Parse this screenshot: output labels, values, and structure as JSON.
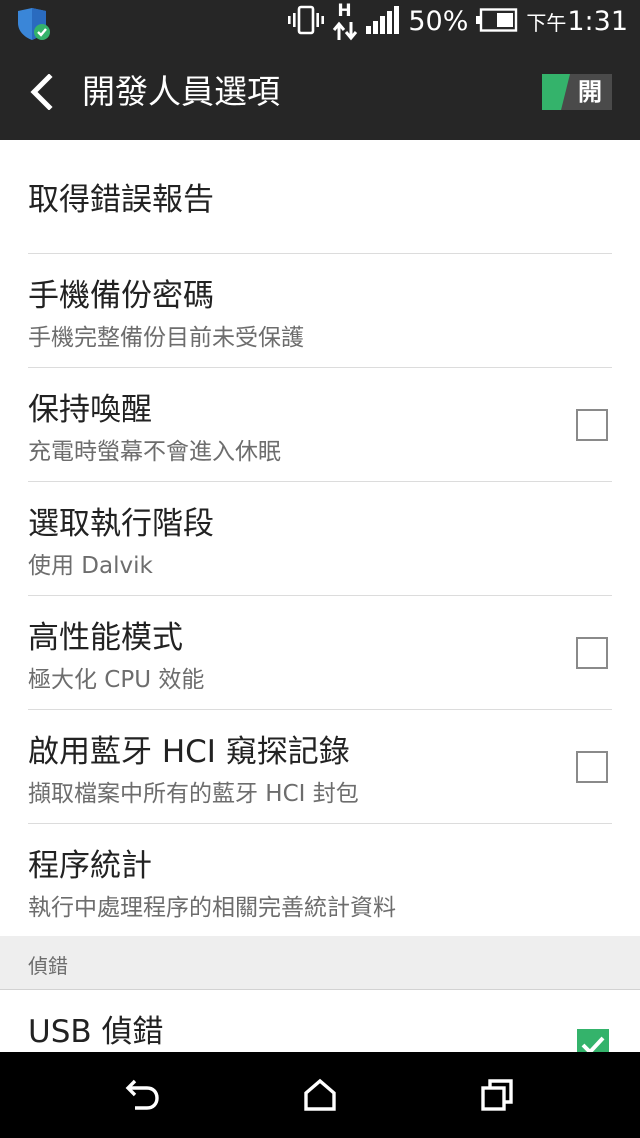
{
  "status_bar": {
    "signal_type": "H",
    "battery_percent": "50%",
    "ampm": "下午",
    "time": "1:31",
    "icons": [
      "shield-check-icon",
      "vibrate-icon",
      "data-arrows-icon",
      "signal-bars-icon",
      "battery-icon"
    ]
  },
  "header": {
    "title": "開發人員選項",
    "toggle_label": "開"
  },
  "settings": [
    {
      "title": "取得錯誤報告",
      "subtitle": ""
    },
    {
      "title": "手機備份密碼",
      "subtitle": "手機完整備份目前未受保護"
    },
    {
      "title": "保持喚醒",
      "subtitle": "充電時螢幕不會進入休眠",
      "checked": false
    },
    {
      "title": "選取執行階段",
      "subtitle": "使用 Dalvik"
    },
    {
      "title": "高性能模式",
      "subtitle": "極大化 CPU 效能",
      "checked": false
    },
    {
      "title": "啟用藍牙 HCI 窺探記錄",
      "subtitle": "擷取檔案中所有的藍牙 HCI 封包",
      "checked": false
    },
    {
      "title": "程序統計",
      "subtitle": "執行中處理程序的相關完善統計資料"
    }
  ],
  "debug_section": {
    "header": "偵錯",
    "usb_debug_title": "USB 偵錯",
    "usb_debug_checked": true
  },
  "nav": {
    "icons": [
      "back-icon",
      "home-icon",
      "recent-apps-icon"
    ]
  },
  "colors": {
    "bar_background": "#262626",
    "accent_green": "#34b36b",
    "toggle_background": "#4a4a4a",
    "section_background": "#eeeeee"
  }
}
